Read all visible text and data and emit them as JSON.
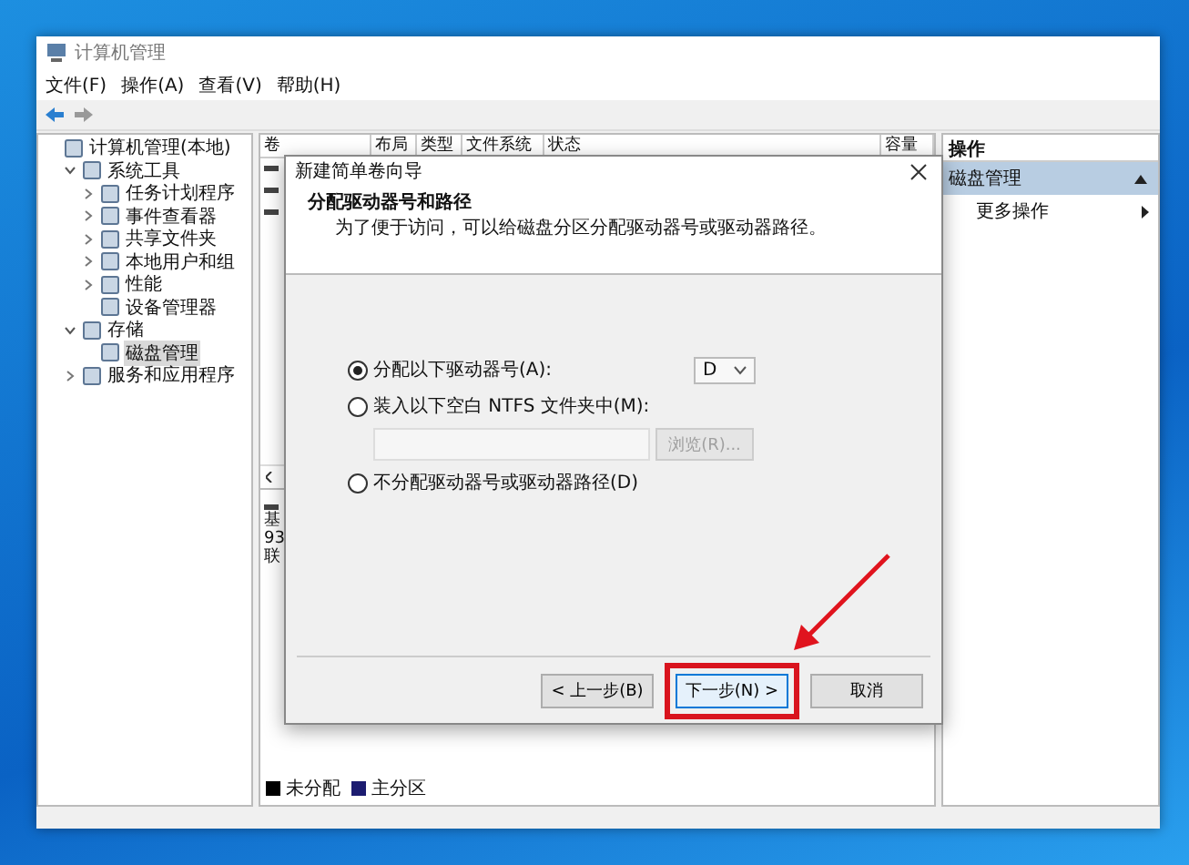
{
  "window": {
    "title": "计算机管理"
  },
  "menu": [
    "文件(F)",
    "操作(A)",
    "查看(V)",
    "帮助(H)"
  ],
  "tree": [
    {
      "label": "计算机管理(本地)",
      "selected": false,
      "children": [
        {
          "label": "系统工具",
          "selected": false,
          "expanded": true,
          "children": [
            {
              "label": "任务计划程序",
              "selected": false,
              "expanded": false
            },
            {
              "label": "事件查看器",
              "selected": false,
              "expanded": false
            },
            {
              "label": "共享文件夹",
              "selected": false,
              "expanded": false
            },
            {
              "label": "本地用户和组",
              "selected": false,
              "expanded": false
            },
            {
              "label": "性能",
              "selected": false,
              "expanded": false
            },
            {
              "label": "设备管理器",
              "selected": false
            }
          ]
        },
        {
          "label": "存储",
          "selected": false,
          "expanded": true,
          "children": [
            {
              "label": "磁盘管理",
              "selected": true
            }
          ]
        },
        {
          "label": "服务和应用程序",
          "selected": false,
          "expanded": false
        }
      ]
    }
  ],
  "volume_table": {
    "columns": [
      "卷",
      "布局",
      "类型",
      "文件系统",
      "状态",
      "容量"
    ]
  },
  "disk_info": [
    "基",
    "93",
    "联"
  ],
  "legend": [
    {
      "label": "未分配",
      "color": "#000000"
    },
    {
      "label": "主分区",
      "color": "#1c1c70"
    }
  ],
  "actions": {
    "header": "操作",
    "section": "磁盘管理",
    "items": [
      "更多操作"
    ]
  },
  "dialog": {
    "title": "新建简单卷向导",
    "heading": "分配驱动器号和路径",
    "description": "为了便于访问，可以给磁盘分区分配驱动器号或驱动器路径。",
    "options": [
      {
        "label": "分配以下驱动器号(A):",
        "selected": true,
        "value": "D"
      },
      {
        "label": "装入以下空白 NTFS 文件夹中(M):",
        "selected": false,
        "browse_button": {
          "label": "浏览(R)...",
          "disabled": true
        }
      },
      {
        "label": "不分配驱动器号或驱动器路径(D)",
        "selected": false
      }
    ],
    "buttons": [
      {
        "label": "< 上一步(B)",
        "highlighted": false
      },
      {
        "label": "下一步(N) >",
        "highlighted": true
      },
      {
        "label": "取消",
        "highlighted": false
      }
    ]
  }
}
